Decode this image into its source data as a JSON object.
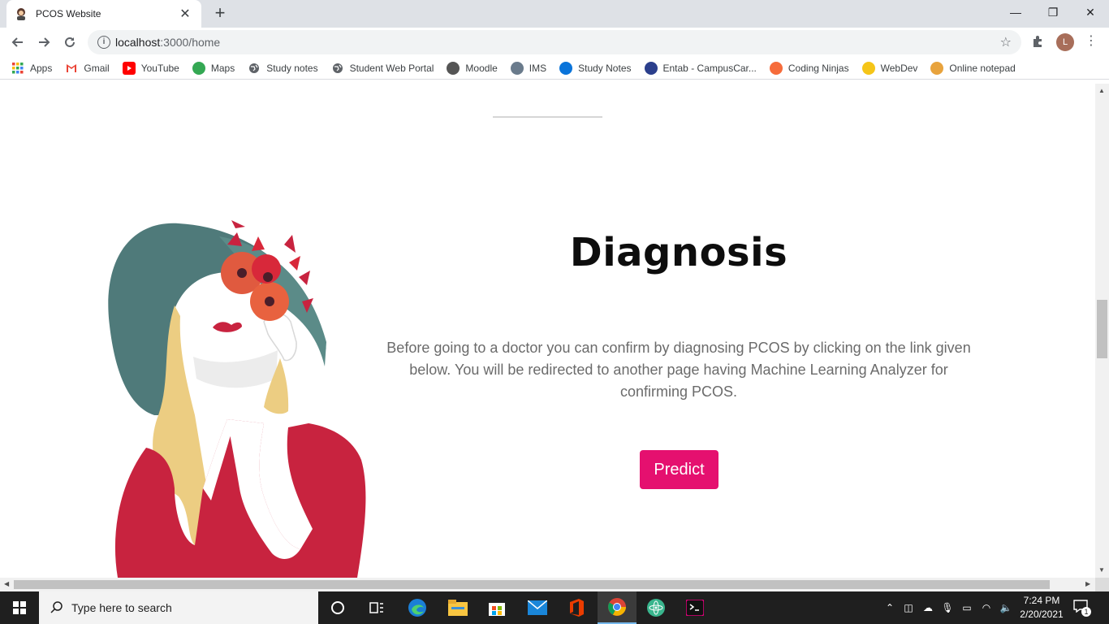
{
  "browser": {
    "tab_title": "PCOS Website",
    "tab_close": "✕",
    "new_tab": "+",
    "url_host": "localhost",
    "url_path": ":3000/home",
    "profile_initial": "L",
    "window_controls": {
      "minimize": "—",
      "restore": "❐",
      "close": "✕"
    }
  },
  "bookmarks": [
    {
      "label": "Apps",
      "icon": "apps-grid-icon",
      "color": "#e8453c"
    },
    {
      "label": "Gmail",
      "icon": "gmail-icon",
      "color": "#ea4335"
    },
    {
      "label": "YouTube",
      "icon": "youtube-icon",
      "color": "#ff0000"
    },
    {
      "label": "Maps",
      "icon": "maps-icon",
      "color": "#34a853"
    },
    {
      "label": "Study notes",
      "icon": "globe-icon",
      "color": "#5f6368"
    },
    {
      "label": "Student Web Portal",
      "icon": "globe-icon",
      "color": "#5f6368"
    },
    {
      "label": "Moodle",
      "icon": "moodle-icon",
      "color": "#555555"
    },
    {
      "label": "IMS",
      "icon": "ims-icon",
      "color": "#6a7b8c"
    },
    {
      "label": "Study Notes",
      "icon": "onedrive-icon",
      "color": "#0a74da"
    },
    {
      "label": "Entab - CampusCar...",
      "icon": "entab-icon",
      "color": "#2b3f8c"
    },
    {
      "label": "Coding Ninjas",
      "icon": "coding-ninjas-icon",
      "color": "#f66c3b"
    },
    {
      "label": "WebDev",
      "icon": "webdev-icon",
      "color": "#f5c518"
    },
    {
      "label": "Online notepad",
      "icon": "notepad-icon",
      "color": "#e8a33d"
    }
  ],
  "page": {
    "heading": "Diagnosis",
    "description": "Before going to a doctor you can confirm by diagnosing PCOS by clicking on the link given below. You will be redirected to another page having Machine Learning Analyzer for confirming PCOS.",
    "predict_label": "Predict",
    "accent_color": "#e5106f"
  },
  "taskbar": {
    "search_placeholder": "Type here to search",
    "time": "7:24 PM",
    "date": "2/20/2021",
    "notification_count": "1"
  }
}
